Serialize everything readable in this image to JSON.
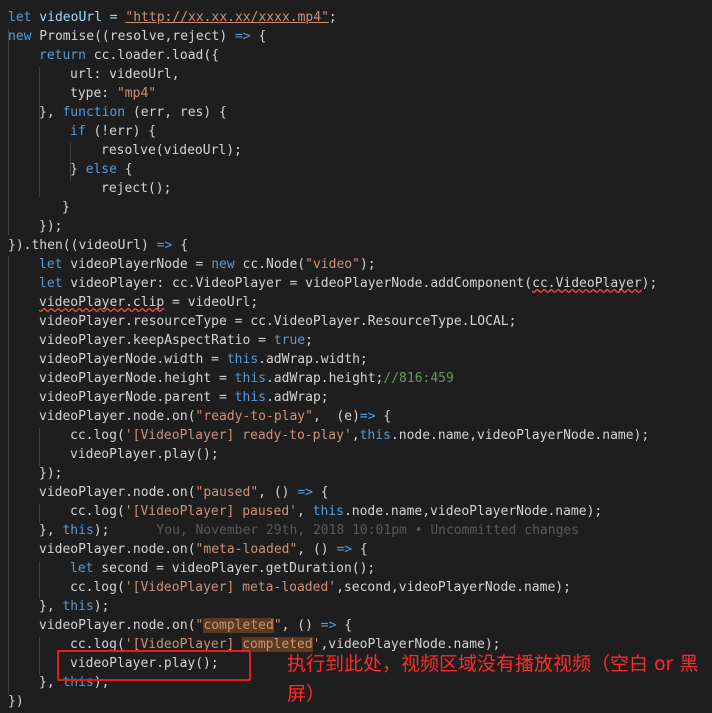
{
  "code": {
    "l01": {
      "a": "let",
      "b": " videoUrl = ",
      "c": "\"http://xx.xx.xx/xxxx.mp4\"",
      "d": ";"
    },
    "l02": {
      "a": "new",
      "b": " Promise((resolve,reject) ",
      "c": "=>",
      "d": " {"
    },
    "l03": {
      "a": "return",
      "b": " cc.loader.load({"
    },
    "l04": {
      "a": "url: videoUrl,"
    },
    "l05": {
      "a": "type: ",
      "b": "\"mp4\""
    },
    "l06": {
      "a": "}, ",
      "b": "function",
      "c": " (err, res) {"
    },
    "l07": {
      "a": "if",
      "b": " (!err) {"
    },
    "l08": {
      "a": "resolve(videoUrl);"
    },
    "l09": {
      "a": "} ",
      "b": "else",
      "c": " {"
    },
    "l10": {
      "a": "reject();"
    },
    "l11": {
      "a": "}"
    },
    "l12": {
      "a": "});"
    },
    "l13": {
      "a": "}).then((videoUrl) ",
      "b": "=>",
      "c": " {"
    },
    "l14": {
      "a": "let",
      "b": " videoPlayerNode = ",
      "c": "new",
      "d": " cc.Node(",
      "e": "\"video\"",
      "f": ");"
    },
    "l15": {
      "a": "let",
      "b": " videoPlayer: cc.VideoPlayer = videoPlayerNode.addComponent(",
      "c": "cc.VideoPlayer",
      "d": ");"
    },
    "l16": {
      "a": "videoPlayer.clip",
      "b": " = videoUrl;"
    },
    "l17": {
      "a": "videoPlayer.resourceType = cc.VideoPlayer.ResourceType.LOCAL;"
    },
    "l18": {
      "a": "videoPlayer.keepAspectRatio = ",
      "b": "true",
      "c": ";"
    },
    "l19": {
      "a": "videoPlayerNode.width = ",
      "b": "this",
      "c": ".adWrap.width;"
    },
    "l20": {
      "a": "videoPlayerNode.height = ",
      "b": "this",
      "c": ".adWrap.height;",
      "d": "//816:459"
    },
    "l21": {
      "a": "videoPlayerNode.parent = ",
      "b": "this",
      "c": ".adWrap;"
    },
    "l22": {
      "a": "videoPlayer.node.on(",
      "b": "\"ready-to-play\"",
      "c": ",  (e)",
      "d": "=>",
      "e": " {"
    },
    "l23": {
      "a": "cc.log(",
      "b": "'[VideoPlayer] ready-to-play'",
      "c": ",",
      "d": "this",
      "e": ".node.name,videoPlayerNode.name);"
    },
    "l24": {
      "a": "videoPlayer.play();"
    },
    "l25": {
      "a": "});"
    },
    "l26": {
      "a": "videoPlayer.node.on(",
      "b": "\"paused\"",
      "c": ", () ",
      "d": "=>",
      "e": " {"
    },
    "l27": {
      "a": "cc.log(",
      "b": "'[VideoPlayer] paused'",
      "c": ", ",
      "d": "this",
      "e": ".node.name,videoPlayerNode.name);"
    },
    "l28": {
      "a": "}, ",
      "b": "this",
      "c": ");",
      "d": "      You, November 29th, 2018 10:01pm • Uncommitted changes"
    },
    "l29": {
      "a": "videoPlayer.node.on(",
      "b": "\"meta-loaded\"",
      "c": ", () ",
      "d": "=>",
      "e": " {"
    },
    "l30": {
      "a": "let",
      "b": " second = videoPlayer.getDuration();"
    },
    "l31": {
      "a": "cc.log(",
      "b": "'[VideoPlayer] meta-loaded'",
      "c": ",second,videoPlayerNode.name);"
    },
    "l32": {
      "a": "}, ",
      "b": "this",
      "c": ");"
    },
    "l33": {
      "a": "videoPlayer.node.on(",
      "b": "\"",
      "c": "completed",
      "d": "\"",
      "e": ", () ",
      "f": "=>",
      "g": " {"
    },
    "l34": {
      "a": "cc.log(",
      "b": "'[VideoPlayer] ",
      "c": "completed",
      "d": "'",
      "e": ",videoPlayerNode.name);"
    },
    "l35": {
      "a": "videoPlayer.play();"
    },
    "l36": {
      "a": "}, ",
      "b": "this",
      "c": ");"
    },
    "l37": {
      "a": "})"
    }
  },
  "annotation": {
    "text": "执行到此处，视频区域没有播放视频（空白 or 黑屏）"
  },
  "colors": {
    "background": "#1e1e1e",
    "keyword": "#569cd6",
    "string": "#ce9178",
    "comment": "#6a9955",
    "annotation_red": "#ff2a2a"
  }
}
